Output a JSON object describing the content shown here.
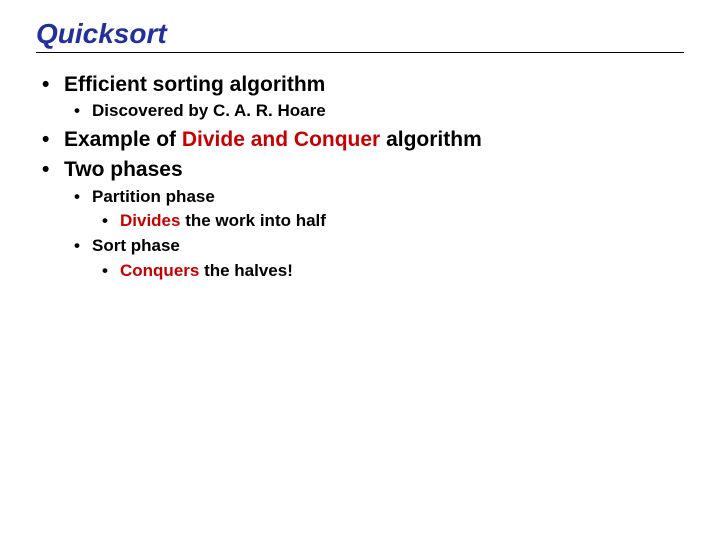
{
  "title": "Quicksort",
  "b1": "Efficient sorting algorithm",
  "b1a": "Discovered by C. A. R. Hoare",
  "b2_pre": "Example of ",
  "b2_red": "Divide and Conquer",
  "b2_post": " algorithm",
  "b3": "Two phases",
  "b3a": "Partition phase",
  "b3a1_red": "Divides",
  "b3a1_post": " the work into half",
  "b3b": "Sort phase",
  "b3b1_red": "Conquers",
  "b3b1_post": " the halves!"
}
